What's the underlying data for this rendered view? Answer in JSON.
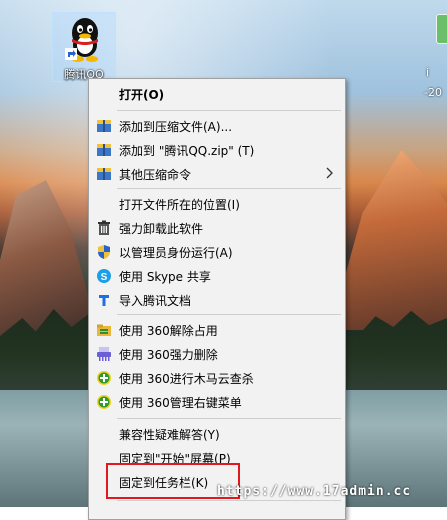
{
  "desktop": {
    "icon_label": "腾讯QQ",
    "right_icon_label_1": "i",
    "right_icon_label_2": "-20"
  },
  "menu": {
    "items": [
      {
        "label": "打开(O)",
        "icon": "none",
        "bold": true
      },
      {
        "label": "添加到压缩文件(A)...",
        "icon": "archive-icon"
      },
      {
        "label": "添加到 \"腾讯QQ.zip\" (T)",
        "icon": "archive-icon"
      },
      {
        "label": "其他压缩命令",
        "icon": "archive-icon",
        "submenu": true
      },
      {
        "label": "打开文件所在的位置(I)",
        "icon": "none"
      },
      {
        "label": "强力卸载此软件",
        "icon": "uninstall-icon"
      },
      {
        "label": "以管理员身份运行(A)",
        "icon": "uac-shield-icon"
      },
      {
        "label": "使用 Skype 共享",
        "icon": "skype-icon"
      },
      {
        "label": "导入腾讯文档",
        "icon": "tencent-docs-icon"
      },
      {
        "label": "使用 360解除占用",
        "icon": "folder-360-icon"
      },
      {
        "label": "使用 360强力删除",
        "icon": "shredder-360-icon"
      },
      {
        "label": "使用 360进行木马云查杀",
        "icon": "plus-360-icon"
      },
      {
        "label": "使用 360管理右键菜单",
        "icon": "plus-360-icon"
      },
      {
        "label": "兼容性疑难解答(Y)",
        "icon": "none"
      },
      {
        "label": "固定到\"开始\"屏幕(P)",
        "icon": "none"
      },
      {
        "label": "固定到任务栏(K)",
        "icon": "none"
      }
    ]
  },
  "watermark": "https://www.17admin.cc",
  "colors": {
    "highlight_box": "#e0191f",
    "menu_bg": "#f2f2f2"
  }
}
